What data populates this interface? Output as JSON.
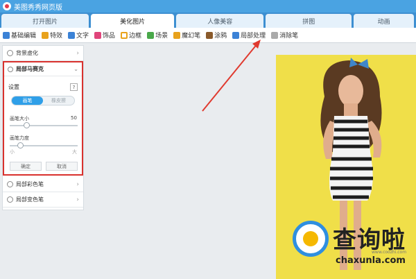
{
  "app": {
    "title": "美图秀秀网页版"
  },
  "tabs": [
    {
      "label": "打开图片",
      "active": false
    },
    {
      "label": "美化图片",
      "active": true
    },
    {
      "label": "人像美容",
      "active": false
    },
    {
      "label": "拼图",
      "active": false
    },
    {
      "label": "动画",
      "active": false
    }
  ],
  "toolbar": [
    {
      "label": "基础编辑",
      "icon": "edit-icon",
      "color": "#3b82d6"
    },
    {
      "label": "特效",
      "icon": "magic-wand-icon",
      "color": "#e8a21c"
    },
    {
      "label": "文字",
      "icon": "text-icon",
      "color": "#3b82d6"
    },
    {
      "label": "饰品",
      "icon": "bow-icon",
      "color": "#e0457b"
    },
    {
      "label": "边框",
      "icon": "frame-icon",
      "color": "#e8a21c"
    },
    {
      "label": "场景",
      "icon": "scene-icon",
      "color": "#49a84a"
    },
    {
      "label": "魔幻笔",
      "icon": "magic-pen-icon",
      "color": "#e8a21c"
    },
    {
      "label": "涂鸦",
      "icon": "brush-icon",
      "color": "#8a5a2b"
    },
    {
      "label": "局部处理",
      "icon": "local-brush-icon",
      "color": "#3b82d6"
    },
    {
      "label": "消除笔",
      "icon": "eraser-icon",
      "color": "#7c7c7c"
    }
  ],
  "panel": {
    "items_top": [
      {
        "label": "背景虚化"
      }
    ],
    "section": {
      "title": "局部马赛克",
      "settings_label": "设置",
      "help": "?",
      "modes": [
        {
          "label": "画笔",
          "active": true
        },
        {
          "label": "橡皮擦",
          "active": false
        }
      ],
      "brush_size_label": "画笔大小",
      "brush_size_value": "50",
      "brush_size_fraction": 0.22,
      "brush_strength_label": "画笔力度",
      "strength_min": "小",
      "strength_max": "大",
      "brush_strength_fraction": 0.12,
      "confirm": "确定",
      "cancel": "取消"
    },
    "items_bottom": [
      {
        "label": "局部彩色笔"
      },
      {
        "label": "局部变色笔"
      }
    ]
  },
  "watermark": {
    "brand": "查询啦",
    "domain": "chaxunla.com",
    "small": "www.coozhi.com"
  },
  "colors": {
    "accent": "#2f9fe8",
    "highlight": "#d9312d",
    "photo_bg": "#f0df49"
  }
}
